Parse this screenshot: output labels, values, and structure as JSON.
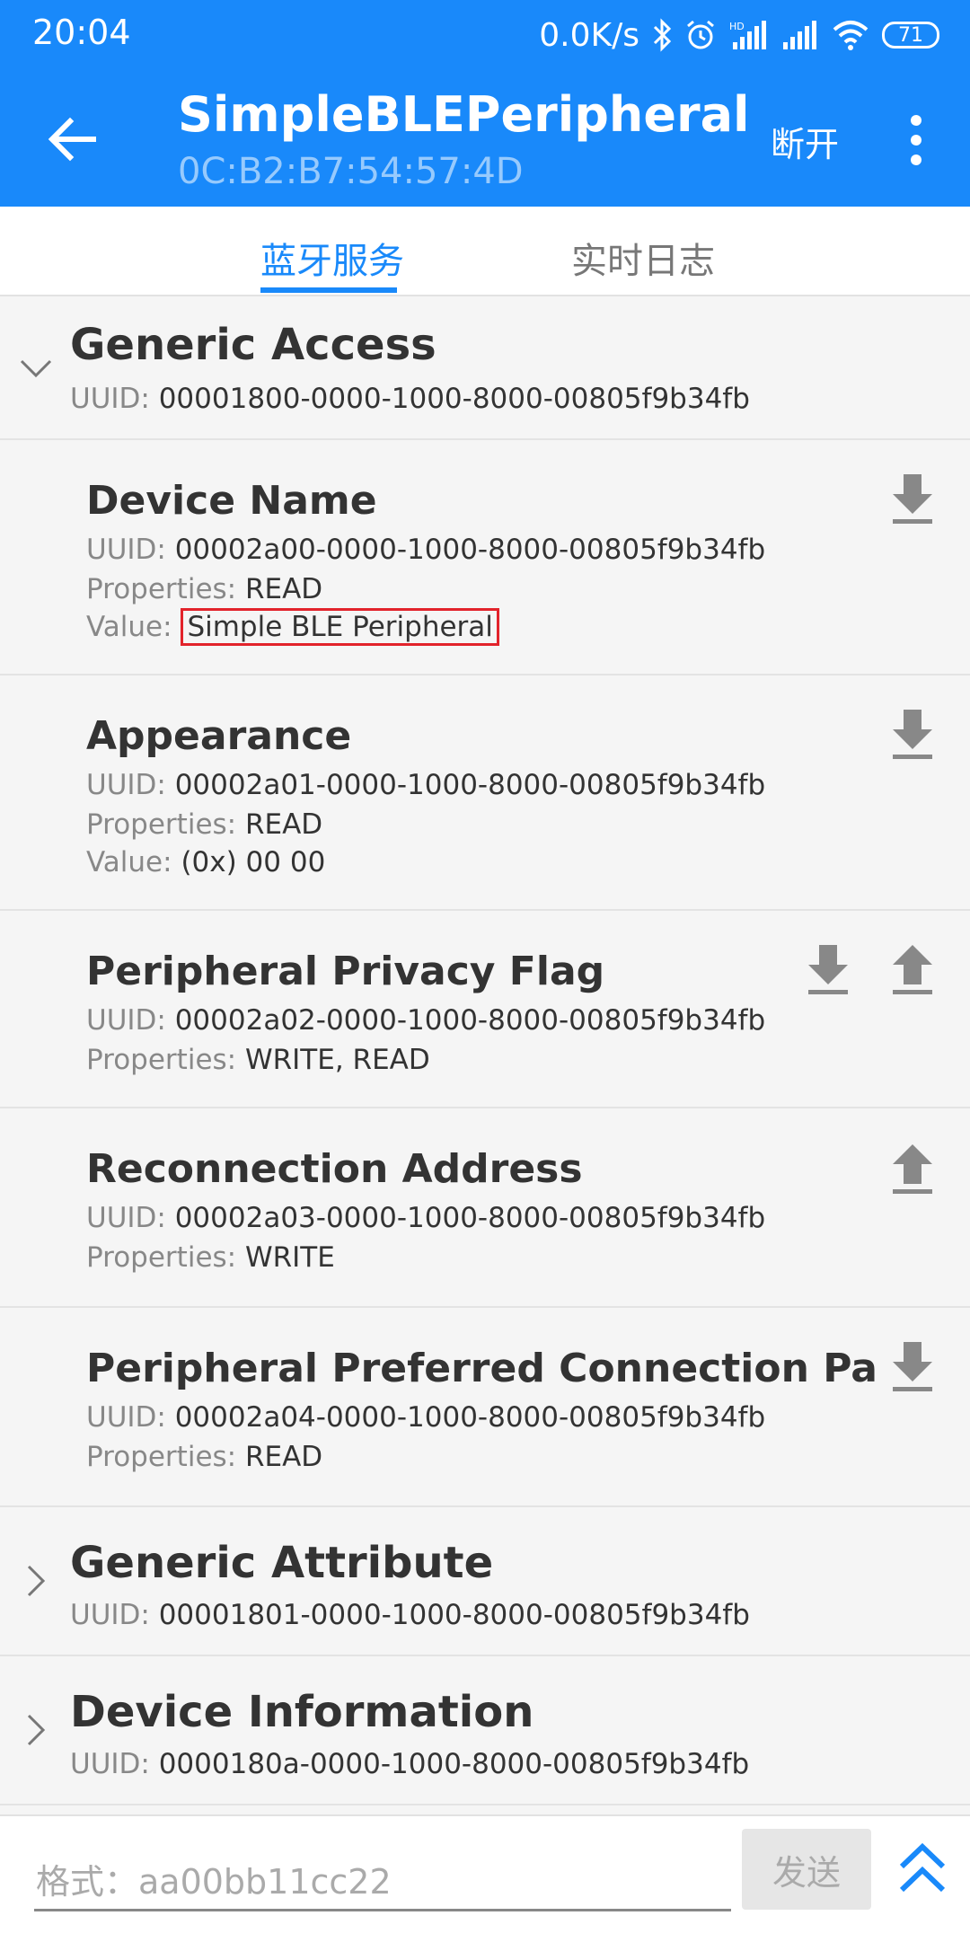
{
  "status_bar": {
    "time": "20:04",
    "net_speed": "0.0K/s",
    "battery": "71"
  },
  "header": {
    "title": "SimpleBLEPeripheral",
    "subtitle": "0C:B2:B7:54:57:4D",
    "disconnect_label": "断开"
  },
  "tabs": [
    {
      "label": "蓝牙服务"
    },
    {
      "label": "实时日志"
    }
  ],
  "labels": {
    "uuid": "UUID: ",
    "properties": "Properties: ",
    "value": "Value: "
  },
  "services": [
    {
      "name": "Generic Access",
      "uuid": "00001800-0000-1000-8000-00805f9b34fb",
      "characteristics": [
        {
          "name": "Device Name",
          "uuid": "00002a00-0000-1000-8000-00805f9b34fb",
          "properties": "READ",
          "value": "Simple BLE Peripheral"
        },
        {
          "name": "Appearance",
          "uuid": "00002a01-0000-1000-8000-00805f9b34fb",
          "properties": "READ",
          "value": "(0x) 00 00"
        },
        {
          "name": "Peripheral Privacy Flag",
          "uuid": "00002a02-0000-1000-8000-00805f9b34fb",
          "properties": "WRITE, READ"
        },
        {
          "name": "Reconnection Address",
          "uuid": "00002a03-0000-1000-8000-00805f9b34fb",
          "properties": "WRITE"
        },
        {
          "name": "Peripheral Preferred Connection Paramete…",
          "uuid": "00002a04-0000-1000-8000-00805f9b34fb",
          "properties": "READ"
        }
      ]
    },
    {
      "name": "Generic Attribute",
      "uuid": "00001801-0000-1000-8000-00805f9b34fb"
    },
    {
      "name": "Device Information",
      "uuid": "0000180a-0000-1000-8000-00805f9b34fb"
    }
  ],
  "input": {
    "placeholder": "格式：aa00bb11cc22",
    "send_label": "发送"
  },
  "colors": {
    "primary": "#1989fa",
    "highlight_border": "#e2232b"
  }
}
